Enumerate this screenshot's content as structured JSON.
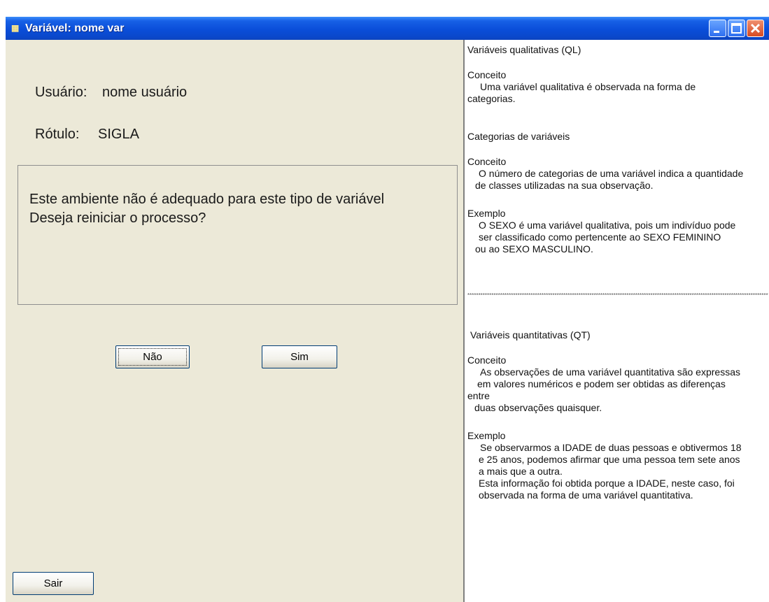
{
  "window": {
    "title": "Variável: nome var",
    "icon": "app-icon",
    "controls": [
      "minimize-icon",
      "maximize-icon",
      "close-icon"
    ]
  },
  "left": {
    "user_label": "Usuário:",
    "user_value": "nome usuário",
    "label_label": "Rótulo:",
    "label_value": "SIGLA",
    "message_line1": "Este ambiente não é adequado para este tipo de variável",
    "message_line2": "Deseja reiniciar o processo?",
    "btn_no": "Não",
    "btn_yes": "Sim",
    "btn_exit": "Sair"
  },
  "help": {
    "ql_title": "Variáveis qualitativas (QL)",
    "ql_concept_head": "Conceito",
    "ql_concept_1": "Uma variável qualitativa é observada na forma de",
    "ql_concept_2": "categorias.",
    "cat_title": "Categorias de variáveis",
    "cat_concept_head": "Conceito",
    "cat_concept_1": "O número de categorias de uma variável indica a quantidade",
    "cat_concept_2": "de classes utilizadas na sua observação.",
    "ql_example_head": "Exemplo",
    "ql_example_1": "O SEXO é uma variável qualitativa, pois um indivíduo pode",
    "ql_example_2": "ser classificado como pertencente ao SEXO FEMININO",
    "ql_example_3": "ou ao SEXO MASCULINO.",
    "separator": "***************************************************************************************************************************************************************",
    "qt_title": "Variáveis quantitativas (QT)",
    "qt_concept_head": "Conceito",
    "qt_concept_1": "As observações de uma variável quantitativa são expressas",
    "qt_concept_2": "em valores numéricos e podem ser obtidas as diferenças",
    "qt_concept_3": "entre",
    "qt_concept_4": "duas observações quaisquer.",
    "qt_example_head": "Exemplo",
    "qt_example_1": "Se observarmos a IDADE de duas pessoas e obtivermos 18",
    "qt_example_2": "e 25 anos,  podemos afirmar que uma pessoa tem sete anos",
    "qt_example_3": "a mais que a outra.",
    "qt_example_4": "Esta informação foi obtida porque a IDADE, neste caso, foi",
    "qt_example_5": "observada na forma de uma variável quantitativa."
  }
}
